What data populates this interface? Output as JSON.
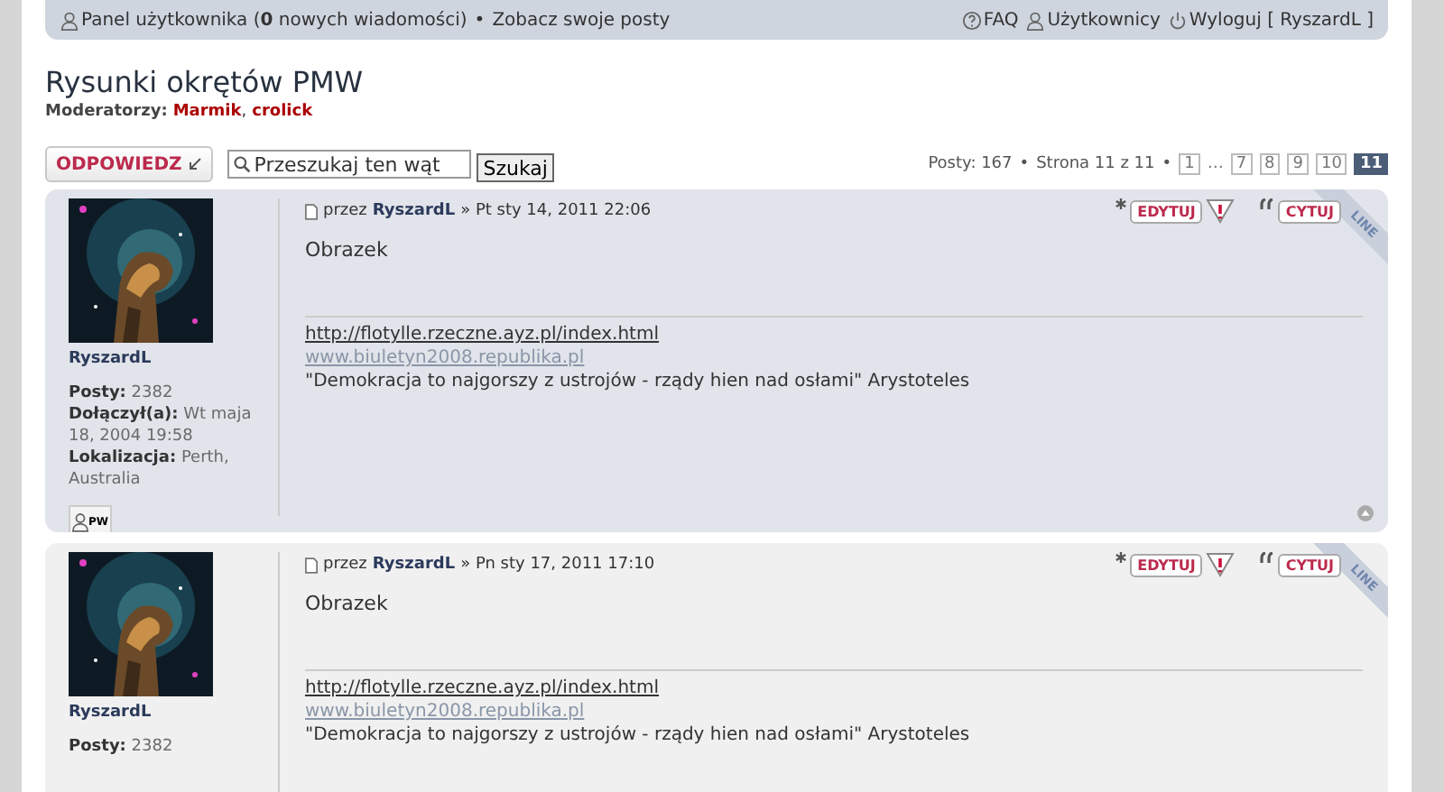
{
  "top_bar": {
    "separator": "•",
    "left": [
      {
        "kind": "ucp",
        "before": "Panel użytkownika (",
        "count": "0",
        "after": " nowych wiadomości)"
      },
      {
        "kind": "link",
        "text": "Zobacz swoje posty"
      }
    ],
    "right": [
      {
        "kind": "faq",
        "text": "FAQ"
      },
      {
        "kind": "users",
        "text": "Użytkownicy"
      },
      {
        "kind": "logout",
        "text": "Wyloguj [ RyszardL ]"
      }
    ]
  },
  "topic": {
    "title": "Rysunki okrętów PMW",
    "moderators_label": "Moderatorzy:",
    "moderators": [
      "Marmik",
      "crolick"
    ],
    "moderator_separator": ","
  },
  "actions": {
    "reply_button": "ODPOWIEDZ",
    "search": {
      "value": "Przeszukaj ten wąt"
    },
    "search_button": "Szukaj"
  },
  "pagination": {
    "separator": "•",
    "posts": "Posty: 167",
    "page_info": "Strona 11 z 11",
    "pages": [
      {
        "label": "1",
        "selected": false
      },
      {
        "label": "…",
        "kind": "ellipsis"
      },
      {
        "label": "7",
        "selected": false
      },
      {
        "label": "8",
        "selected": false
      },
      {
        "label": "9",
        "selected": false
      },
      {
        "label": "10",
        "selected": false
      },
      {
        "label": "11",
        "selected": true
      }
    ]
  },
  "posts": [
    {
      "kind": "bg1",
      "author": "RyszardL",
      "post_author": "RyszardL",
      "date": "» Pt sty 14, 2011 22:06",
      "by": "przez",
      "body": "Obrazek",
      "links": [
        "http://flotylle.rzeczne.ayz.pl/index.html",
        "www.biuletyn2008.republika.pl"
      ],
      "signature": "\"Demokracja to najgorszy z ustrojów - rządy hien nad osłami\" Arystoteles",
      "edit": "EDYTUJ",
      "quote": "CYTUJ",
      "online": "LINE",
      "profile": [
        {
          "label": "Posty:",
          "value": "2382"
        },
        {
          "label": "Dołączył(a):",
          "value": "Wt maja 18, 2004 19:58"
        },
        {
          "label": "Lokalizacja:",
          "value": "Perth, Australia"
        }
      ],
      "pm": "PW"
    },
    {
      "kind": "bg2",
      "author": "RyszardL",
      "post_author": "RyszardL",
      "date": "» Pn sty 17, 2011 17:10",
      "by": "przez",
      "body": "Obrazek",
      "links": [
        "http://flotylle.rzeczne.ayz.pl/index.html",
        "www.biuletyn2008.republika.pl"
      ],
      "signature": "\"Demokracja to najgorszy z ustrojów - rządy hien nad osłami\" Arystoteles",
      "edit": "EDYTUJ",
      "quote": "CYTUJ",
      "online": "LINE",
      "profile": [
        {
          "label": "Posty:",
          "value": "2382"
        }
      ]
    }
  ]
}
